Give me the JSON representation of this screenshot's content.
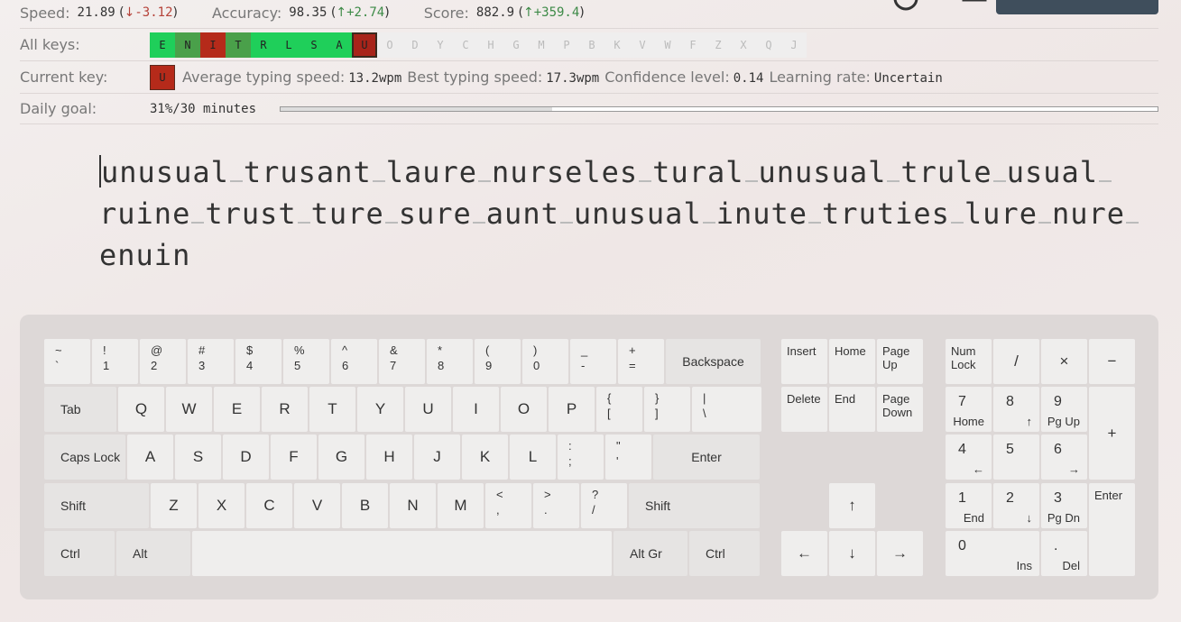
{
  "stats": {
    "speed_label": "Speed:",
    "speed_value": "21.89",
    "speed_delta": "-3.12",
    "accuracy_label": "Accuracy:",
    "accuracy_value": "98.35",
    "accuracy_delta": "+2.74",
    "score_label": "Score:",
    "score_value": "882.9",
    "score_delta": "+359.4"
  },
  "all_keys": {
    "label": "All keys:",
    "keys": [
      {
        "k": "E",
        "state": "g1"
      },
      {
        "k": "N",
        "state": "g2"
      },
      {
        "k": "I",
        "state": "red"
      },
      {
        "k": "T",
        "state": "g2"
      },
      {
        "k": "R",
        "state": "g1"
      },
      {
        "k": "L",
        "state": "g1"
      },
      {
        "k": "S",
        "state": "g1"
      },
      {
        "k": "A",
        "state": "g1"
      },
      {
        "k": "U",
        "state": "sel"
      },
      {
        "k": "O",
        "state": "off"
      },
      {
        "k": "D",
        "state": "off"
      },
      {
        "k": "Y",
        "state": "off"
      },
      {
        "k": "C",
        "state": "off"
      },
      {
        "k": "H",
        "state": "off"
      },
      {
        "k": "G",
        "state": "off"
      },
      {
        "k": "M",
        "state": "off"
      },
      {
        "k": "P",
        "state": "off"
      },
      {
        "k": "B",
        "state": "off"
      },
      {
        "k": "K",
        "state": "off"
      },
      {
        "k": "V",
        "state": "off"
      },
      {
        "k": "W",
        "state": "off"
      },
      {
        "k": "F",
        "state": "off"
      },
      {
        "k": "Z",
        "state": "off"
      },
      {
        "k": "X",
        "state": "off"
      },
      {
        "k": "Q",
        "state": "off"
      },
      {
        "k": "J",
        "state": "off"
      }
    ]
  },
  "current_key": {
    "label": "Current key:",
    "key": "U",
    "avg_label": "Average typing speed:",
    "avg_value": "13.2wpm",
    "best_label": "Best typing speed:",
    "best_value": "17.3wpm",
    "conf_label": "Confidence level:",
    "conf_value": "0.14",
    "rate_label": "Learning rate:",
    "rate_value": "Uncertain"
  },
  "daily_goal": {
    "label": "Daily goal:",
    "value": "31%/30 minutes",
    "progress": 0.31
  },
  "text_lines": [
    [
      "unusual",
      "trusant",
      "laure",
      "nurseles",
      "tural",
      "unusual",
      "trule",
      "usual"
    ],
    [
      "ruine",
      "trust",
      "ture",
      "sure",
      "aunt",
      "unusual",
      "inute",
      "truties",
      "lure",
      "nure"
    ],
    [
      "enuin"
    ]
  ],
  "keyboard": {
    "row1": [
      [
        "~",
        "`"
      ],
      [
        "!",
        "1"
      ],
      [
        "@",
        "2"
      ],
      [
        "#",
        "3"
      ],
      [
        "$",
        "4"
      ],
      [
        "%",
        "5"
      ],
      [
        "^",
        "6"
      ],
      [
        "&",
        "7"
      ],
      [
        "*",
        "8"
      ],
      [
        "(",
        "9"
      ],
      [
        ")",
        "0"
      ],
      [
        "_",
        "-"
      ],
      [
        "+",
        "="
      ]
    ],
    "backspace": "Backspace",
    "tab": "Tab",
    "row2": [
      "Q",
      "W",
      "E",
      "R",
      "T",
      "Y",
      "U",
      "I",
      "O",
      "P"
    ],
    "row2_sym": [
      [
        "{",
        "["
      ],
      [
        "}",
        "]"
      ],
      [
        "|",
        "\\"
      ]
    ],
    "caps": "Caps Lock",
    "row3": [
      "A",
      "S",
      "D",
      "F",
      "G",
      "H",
      "J",
      "K",
      "L"
    ],
    "row3_sym": [
      [
        ":",
        ";"
      ],
      [
        "\"",
        "'"
      ]
    ],
    "enter": "Enter",
    "shift": "Shift",
    "row4": [
      "Z",
      "X",
      "C",
      "V",
      "B",
      "N",
      "M"
    ],
    "row4_sym": [
      [
        "<",
        ","
      ],
      [
        ">",
        "."
      ],
      [
        "?",
        "/"
      ]
    ],
    "ctrl": "Ctrl",
    "alt": "Alt",
    "altgr": "Alt Gr",
    "nav": {
      "insert": "Insert",
      "home": "Home",
      "pageup": "Page Up",
      "delete": "Delete",
      "end": "End",
      "pagedown": "Page Down"
    },
    "arrows": {
      "up": "↑",
      "left": "←",
      "down": "↓",
      "right": "→"
    },
    "numpad": {
      "numlock": "Num Lock",
      "div": "/",
      "mul": "×",
      "minus": "−",
      "plus": "+",
      "enter": "Enter",
      "n7": [
        "7",
        "Home"
      ],
      "n8": [
        "8",
        "↑"
      ],
      "n9": [
        "9",
        "Pg Up"
      ],
      "n4": [
        "4",
        "←"
      ],
      "n5": [
        "5",
        ""
      ],
      "n6": [
        "6",
        "→"
      ],
      "n1": [
        "1",
        "End"
      ],
      "n2": [
        "2",
        "↓"
      ],
      "n3": [
        "3",
        "Pg Dn"
      ],
      "n0": [
        "0",
        "Ins"
      ],
      "ndot": [
        ".",
        "Del"
      ]
    }
  }
}
